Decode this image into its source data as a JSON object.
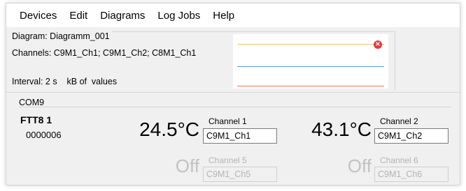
{
  "menu": {
    "items": [
      "Devices",
      "Edit",
      "Diagrams",
      "Log Jobs",
      "Help"
    ]
  },
  "diagram": {
    "title": "Diagram: Diagramm_001",
    "channels": "Channels: C9M1_Ch1; C9M1_Ch2; C8M1_Ch1",
    "interval": "Interval: 2 s    kB of  values",
    "series_colors": [
      "#f2c26a",
      "#5a9fd6",
      "#ec7a52"
    ],
    "close_icon": "close-icon"
  },
  "port": {
    "label": "COM9"
  },
  "device": {
    "name": "FTT8 1",
    "serial": "0000006",
    "channels": [
      {
        "reading": "24.5°C",
        "label": "Channel 1",
        "value": "C9M1_Ch1",
        "enabled": true
      },
      {
        "reading": "43.1°C",
        "label": "Channel 2",
        "value": "C9M1_Ch2",
        "enabled": true
      },
      {
        "reading": "Off",
        "label": "Channel 5",
        "value": "C9M1_Ch5",
        "enabled": false
      },
      {
        "reading": "Off",
        "label": "Channel 6",
        "value": "C9M1_Ch6",
        "enabled": false
      }
    ]
  }
}
